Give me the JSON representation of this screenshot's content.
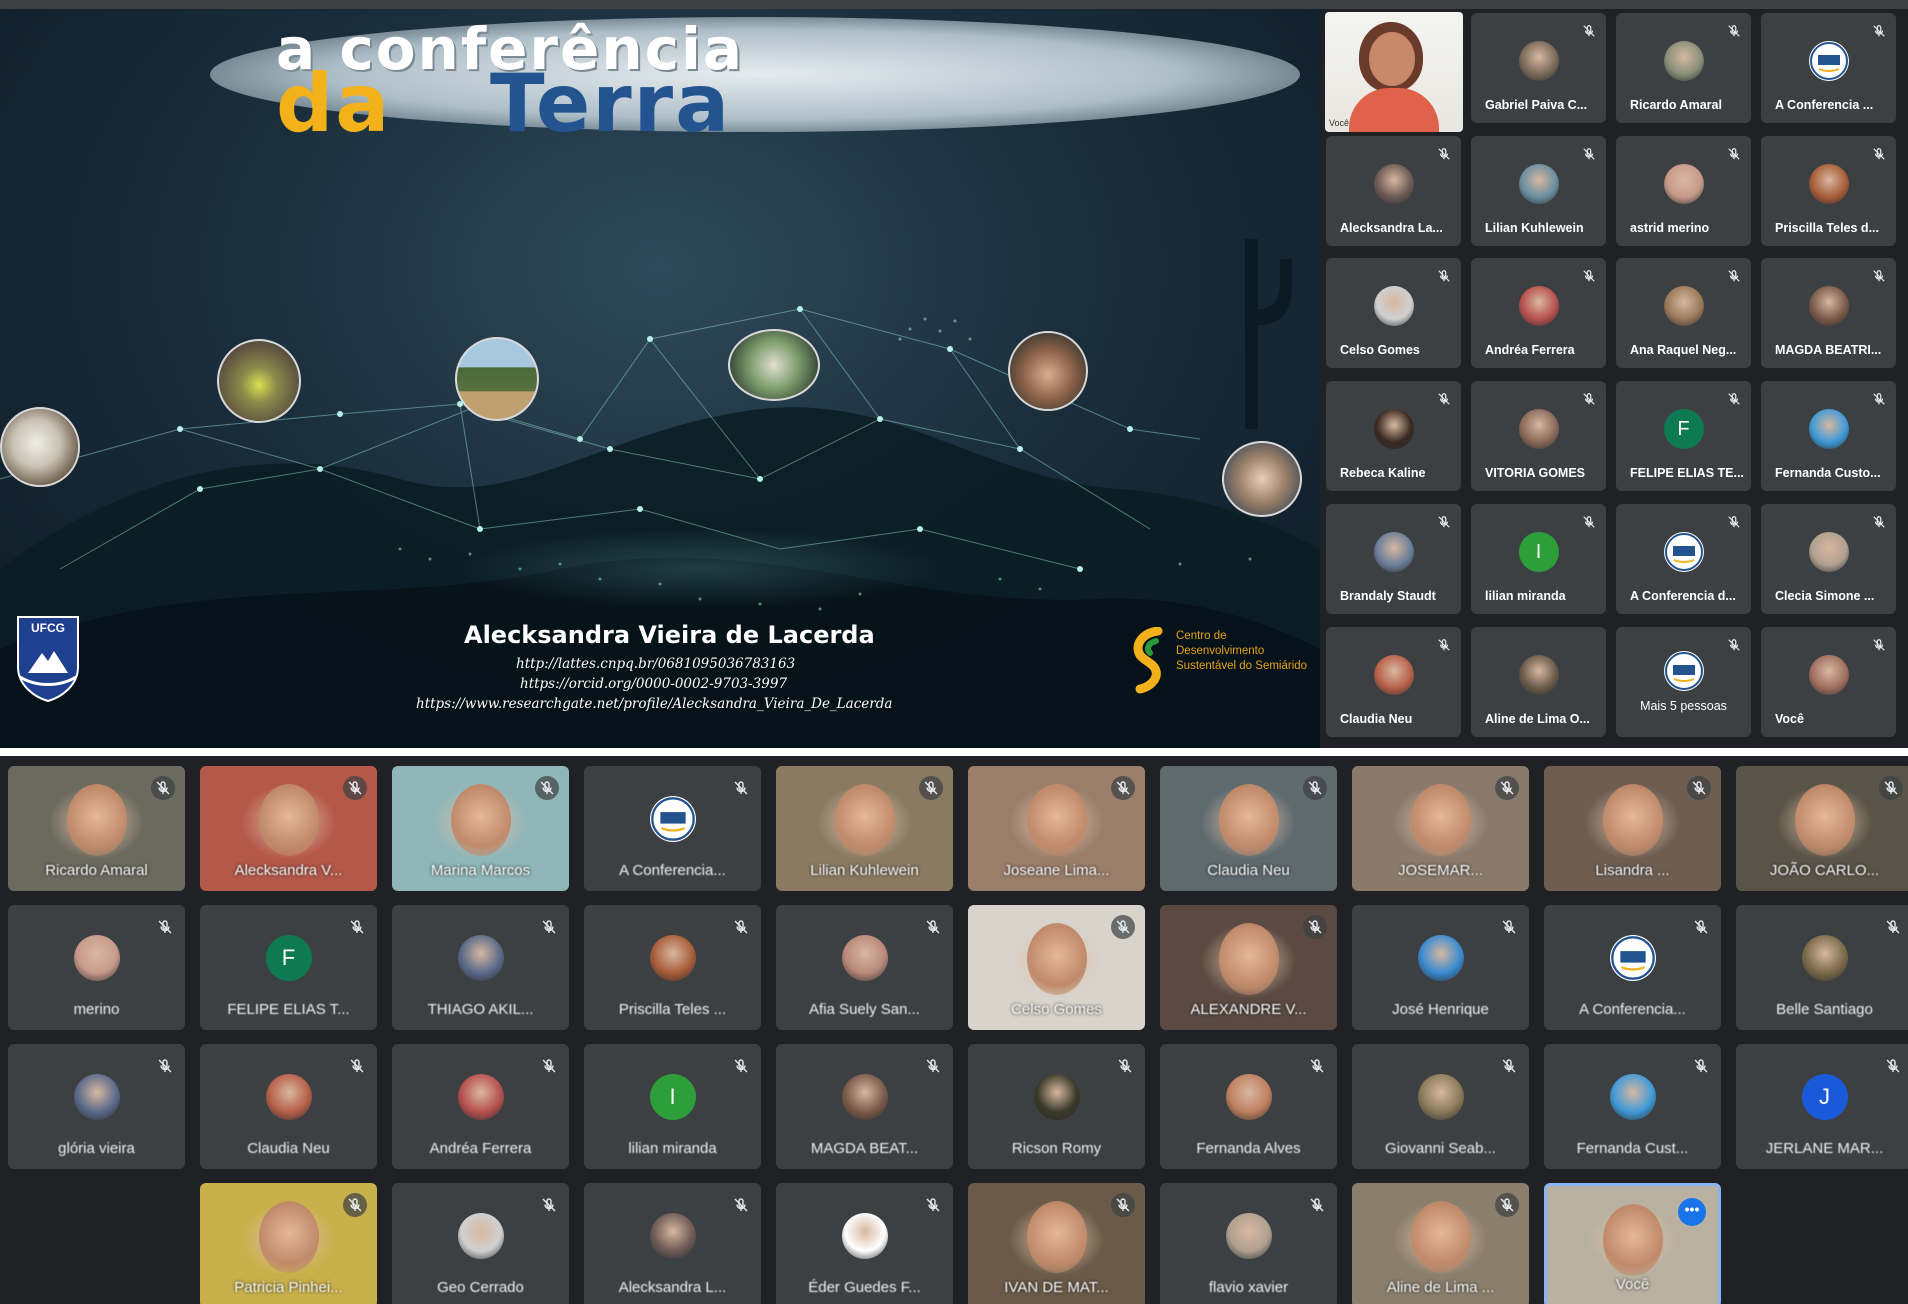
{
  "slide": {
    "title_line1": "a conferência",
    "title_line2a": "da",
    "title_line2b": "Terra",
    "speaker_name": "Alecksandra Vieira de Lacerda",
    "links": [
      "http://lattes.cnpq.br/0681095036783163",
      "https://orcid.org/0000-0002-9703-3997",
      "https://www.researchgate.net/profile/Alecksandra_Vieira_De_Lacerda"
    ],
    "ufcg_label": "UFCG",
    "cds_text": [
      "Centro de",
      "Desenvolvimento",
      "Sustentável do Semiárido"
    ],
    "self_video_label": "Você"
  },
  "top_participants": [
    {
      "name": "Gabriel Paiva C...",
      "avatar_color": "#7a6a5a",
      "initial": ""
    },
    {
      "name": "Ricardo Amaral",
      "avatar_color": "#8a8f7a",
      "initial": ""
    },
    {
      "name": "A Conferencia ...",
      "avatar_color": "#ffffff",
      "initial": "",
      "logo": true
    },
    {
      "name": "Alecksandra La...",
      "avatar_color": "#6d5a55",
      "initial": ""
    },
    {
      "name": "Lilian Kuhlewein",
      "avatar_color": "#6a8fa0",
      "initial": ""
    },
    {
      "name": "astrid merino",
      "avatar_color": "#c79a8a",
      "initial": ""
    },
    {
      "name": "Priscilla Teles d...",
      "avatar_color": "#a85d3a",
      "initial": ""
    },
    {
      "name": "Celso Gomes",
      "avatar_color": "#d0d0d0",
      "initial": ""
    },
    {
      "name": "Andréa Ferrera",
      "avatar_color": "#b85050",
      "initial": ""
    },
    {
      "name": "Ana Raquel Neg...",
      "avatar_color": "#9a7a5a",
      "initial": ""
    },
    {
      "name": "MAGDA BEATRI...",
      "avatar_color": "#7a5a4a",
      "initial": ""
    },
    {
      "name": "Rebeca Kaline",
      "avatar_color": "#3a2a22",
      "initial": ""
    },
    {
      "name": "VITORIA GOMES",
      "avatar_color": "#8a6a5a",
      "initial": ""
    },
    {
      "name": "FELIPE ELIAS TE...",
      "avatar_color": "#0d7a52",
      "initial": "F"
    },
    {
      "name": "Fernanda Custo...",
      "avatar_color": "#3f9ad8",
      "initial": ""
    },
    {
      "name": "Brandaly Staudt",
      "avatar_color": "#6a7f9a",
      "initial": ""
    },
    {
      "name": "lilian miranda",
      "avatar_color": "#2e9e3a",
      "initial": "I"
    },
    {
      "name": "A Conferencia d...",
      "avatar_color": "#ffffff",
      "initial": "",
      "logo": true
    },
    {
      "name": "Clecia Simone ...",
      "avatar_color": "#b0a090",
      "initial": ""
    },
    {
      "name": "Claudia Neu",
      "avatar_color": "#b8604a",
      "initial": ""
    },
    {
      "name": "Aline de Lima O...",
      "avatar_color": "#6a5a4a",
      "initial": ""
    },
    {
      "name": "Mais 5 pessoas",
      "avatar_color": "#ffffff",
      "initial": "",
      "logo": true
    },
    {
      "name": "Você",
      "avatar_color": "#a07060",
      "initial": ""
    }
  ],
  "bottom_participants": [
    {
      "name": "Ricardo Amaral",
      "video": true,
      "bg": "#6b6a5e"
    },
    {
      "name": "Alecksandra V...",
      "video": true,
      "bg": "#b4584a"
    },
    {
      "name": "Marina Marcos",
      "video": true,
      "bg": "#8fb6b8"
    },
    {
      "name": "A Conferencia...",
      "avatar_color": "#ffffff",
      "logo": true
    },
    {
      "name": "Lilian Kuhlewein",
      "video": true,
      "bg": "#8a7a62"
    },
    {
      "name": "Joseane Lima...",
      "video": true,
      "bg": "#9a7e6a"
    },
    {
      "name": "Claudia Neu",
      "video": true,
      "bg": "#5e6a6e"
    },
    {
      "name": "JOSEMAR...",
      "video": true,
      "bg": "#8a7a6c"
    },
    {
      "name": "Lisandra ...",
      "video": true,
      "bg": "#6e5e52"
    },
    {
      "name": "JOÃO CARLO...",
      "video": true,
      "bg": "#5a5448"
    },
    {
      "name": "merino",
      "avatar_color": "#c79a8a"
    },
    {
      "name": "FELIPE ELIAS T...",
      "avatar_color": "#0d7a52",
      "initial": "F"
    },
    {
      "name": "THIAGO AKIL...",
      "avatar_color": "#5a6a8a"
    },
    {
      "name": "Priscilla Teles ...",
      "avatar_color": "#a85d3a"
    },
    {
      "name": "Afia Suely San...",
      "avatar_color": "#b88a7a"
    },
    {
      "name": "Celso Gomes",
      "video": true,
      "bg": "#d8d4cc"
    },
    {
      "name": "ALEXANDRE V...",
      "video": true,
      "bg": "#5a4a42"
    },
    {
      "name": "José Henrique",
      "avatar_color": "#3a8ad0"
    },
    {
      "name": "A Conferencia...",
      "avatar_color": "#ffffff",
      "logo": true
    },
    {
      "name": "Belle Santiago",
      "avatar_color": "#7a6a4a"
    },
    {
      "name": "glória vieira",
      "avatar_color": "#5a6a8a"
    },
    {
      "name": "Claudia Neu",
      "avatar_color": "#b8604a"
    },
    {
      "name": "Andréa Ferrera",
      "avatar_color": "#b85050"
    },
    {
      "name": "lilian miranda",
      "avatar_color": "#2e9e3a",
      "initial": "I"
    },
    {
      "name": "MAGDA BEAT...",
      "avatar_color": "#7a5a4a"
    },
    {
      "name": "Ricson Romy",
      "avatar_color": "#3a3a2a"
    },
    {
      "name": "Fernanda Alves",
      "avatar_color": "#c08060"
    },
    {
      "name": "Giovanni Seab...",
      "avatar_color": "#8a7a5a"
    },
    {
      "name": "Fernanda Cust...",
      "avatar_color": "#3f9ad8"
    },
    {
      "name": "JERLANE MAR...",
      "avatar_color": "#1a5ad8",
      "initial": "J"
    },
    {
      "name": "Patricia Pinhei...",
      "video": true,
      "bg": "#c8b04a"
    },
    {
      "name": "Geo Cerrado",
      "avatar_color": "#d0d0d0"
    },
    {
      "name": "Alecksandra L...",
      "avatar_color": "#6d5a55"
    },
    {
      "name": "Éder Guedes F...",
      "avatar_color": "#ffffff"
    },
    {
      "name": "IVAN DE MAT...",
      "video": true,
      "bg": "#6a5a48"
    },
    {
      "name": "flavio xavier",
      "avatar_color": "#b0a090"
    },
    {
      "name": "Aline de Lima ...",
      "video": true,
      "bg": "#8a7e6c"
    },
    {
      "name": "Você",
      "video": true,
      "bg": "#b8b0a0",
      "self": true
    }
  ]
}
